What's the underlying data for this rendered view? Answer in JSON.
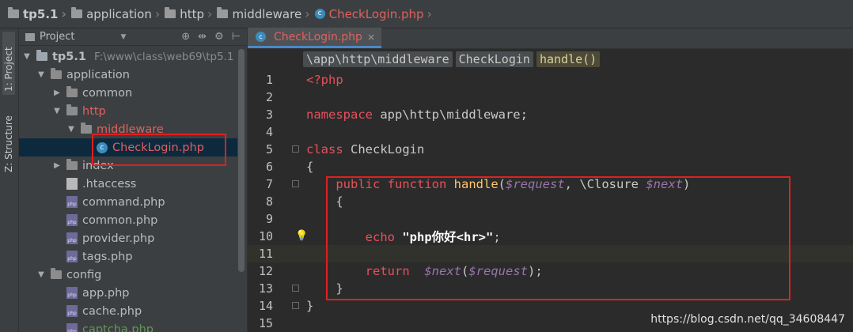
{
  "nav": {
    "crumbs": [
      "tp5.1",
      "application",
      "http",
      "middleware",
      "CheckLogin.php"
    ]
  },
  "toolstrip": {
    "project_tab": "1: Project",
    "structure_tab": "Z: Structure"
  },
  "project": {
    "header": "Project",
    "tools": [
      "⊕",
      "⇹",
      "⚙",
      "⊢"
    ],
    "tree": [
      {
        "label": "tp5.1",
        "path": "F:\\www\\class\\web69\\tp5.1"
      },
      {
        "label": "application"
      },
      {
        "label": "common"
      },
      {
        "label": "http"
      },
      {
        "label": "middleware"
      },
      {
        "label": "CheckLogin.php"
      },
      {
        "label": "index"
      },
      {
        "label": ".htaccess"
      },
      {
        "label": "command.php"
      },
      {
        "label": "common.php"
      },
      {
        "label": "provider.php"
      },
      {
        "label": "tags.php"
      },
      {
        "label": "config"
      },
      {
        "label": "app.php"
      },
      {
        "label": "cache.php"
      },
      {
        "label": "captcha.php"
      }
    ]
  },
  "editor": {
    "tab": "CheckLogin.php",
    "crumbs": [
      "\\app\\http\\middleware",
      "CheckLogin",
      "handle()"
    ],
    "line_numbers": [
      "1",
      "2",
      "3",
      "4",
      "5",
      "6",
      "7",
      "8",
      "9",
      "10",
      "11",
      "12",
      "13",
      "14",
      "15"
    ],
    "code": {
      "l1": "<?php",
      "l3_kw": "namespace",
      "l3_rest": " app\\http\\middleware;",
      "l5_kw": "class",
      "l5_rest": " CheckLogin",
      "l6": "{",
      "l7_kw1": "public",
      "l7_kw2": "function",
      "l7_fn": "handle",
      "l7_p1": "$request",
      "l7_mid": ", \\Closure ",
      "l7_p2": "$next",
      "l8": "{",
      "l10_kw": "echo",
      "l10_str": "\"php你好<hr>\"",
      "l12_kw": "return",
      "l12_call": "$next",
      "l12_arg": "$request",
      "l13": "}",
      "l14": "}"
    }
  },
  "watermark": "https://blog.csdn.net/qq_34608447"
}
